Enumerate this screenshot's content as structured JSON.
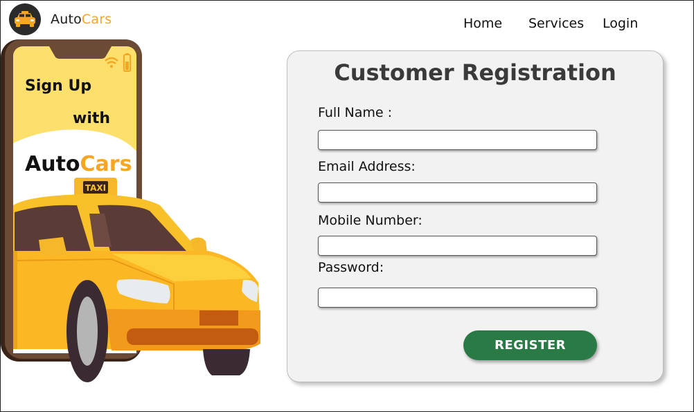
{
  "header": {
    "brand_auto": "Auto",
    "brand_cars": "Cars",
    "logo_icon": "car-icon",
    "nav": {
      "home": "Home",
      "services": "Services",
      "login": "Login"
    }
  },
  "illustration": {
    "line1": "Sign Up",
    "line2": "with",
    "brand_auto": "Auto",
    "brand_cars": "Cars",
    "taxi_sign": "TAXI",
    "icons": [
      "wifi-icon",
      "battery-icon"
    ]
  },
  "form": {
    "title": "Customer Registration",
    "fields": [
      {
        "label": "Full Name :",
        "value": "",
        "placeholder": ""
      },
      {
        "label": "Email Address:",
        "value": "",
        "placeholder": ""
      },
      {
        "label": "Mobile Number:",
        "value": "",
        "placeholder": ""
      },
      {
        "label": "Password:",
        "value": "",
        "placeholder": ""
      }
    ],
    "submit_label": "REGISTER"
  },
  "colors": {
    "accent": "#f6a623",
    "phone_frame": "#6b4a36",
    "phone_screen": "#fddf6b",
    "register_button": "#2a7a46",
    "card_background": "#f2f2f2"
  }
}
